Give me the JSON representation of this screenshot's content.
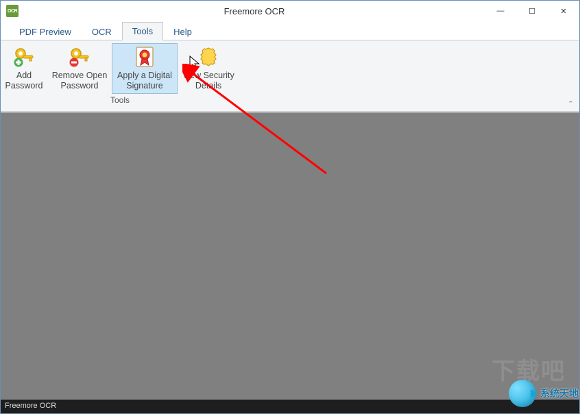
{
  "window": {
    "title": "Freemore OCR",
    "app_icon_text": "OCR"
  },
  "win_controls": {
    "minimize": "—",
    "maximize": "☐",
    "close": "✕"
  },
  "tabs": [
    {
      "label": "PDF Preview",
      "active": false
    },
    {
      "label": "OCR",
      "active": false
    },
    {
      "label": "Tools",
      "active": true
    },
    {
      "label": "Help",
      "active": false
    }
  ],
  "ribbon": {
    "group_label": "Tools",
    "collapse_glyph": "⌃",
    "items": [
      {
        "label_line1": "Add",
        "label_line2": "Password",
        "icon": "key-add"
      },
      {
        "label_line1": "Remove Open",
        "label_line2": "Password",
        "icon": "key-remove"
      },
      {
        "label_line1": "Apply a Digital",
        "label_line2": "Signature",
        "icon": "rosette",
        "hover": true
      },
      {
        "label_line1": "View Security",
        "label_line2": "Details",
        "icon": "shield"
      }
    ]
  },
  "statusbar": {
    "text": "Freemore OCR"
  },
  "watermark": {
    "text": "下载吧"
  },
  "brand": {
    "text": "系统天地"
  }
}
